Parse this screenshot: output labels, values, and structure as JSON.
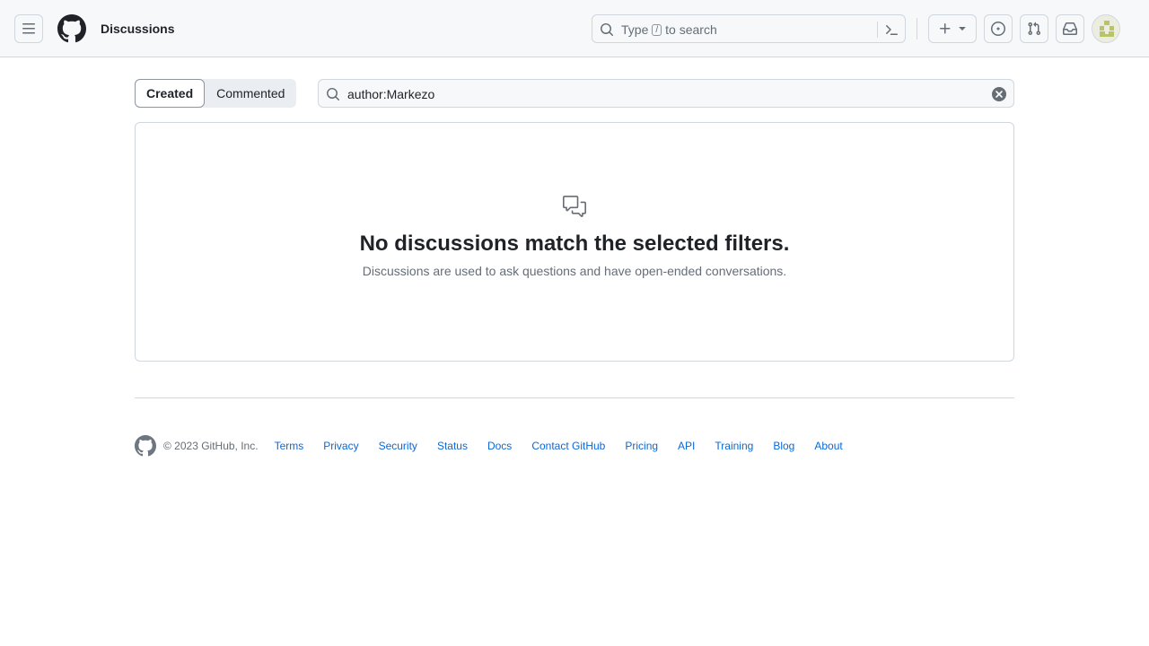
{
  "header": {
    "title": "Discussions",
    "search_prefix": "Type",
    "search_key": "/",
    "search_suffix": "to search",
    "icons": [
      "hamburger-icon",
      "github-logo",
      "search-icon",
      "command-palette-icon",
      "plus-icon",
      "chevron-down-icon",
      "issues-icon",
      "pull-requests-icon",
      "inbox-icon",
      "avatar"
    ]
  },
  "tabs": [
    {
      "label": "Created",
      "active": true
    },
    {
      "label": "Commented",
      "active": false
    }
  ],
  "filter": {
    "value": "author:Markezo"
  },
  "blankslate": {
    "title": "No discussions match the selected filters.",
    "subtitle": "Discussions are used to ask questions and have open-ended conversations."
  },
  "footer": {
    "copyright": "© 2023 GitHub, Inc.",
    "links": [
      "Terms",
      "Privacy",
      "Security",
      "Status",
      "Docs",
      "Contact GitHub",
      "Pricing",
      "API",
      "Training",
      "Blog",
      "About"
    ]
  },
  "colors": {
    "accent": "#0969da",
    "text": "#1f2328",
    "muted": "#656d76",
    "border": "#d0d7de"
  }
}
